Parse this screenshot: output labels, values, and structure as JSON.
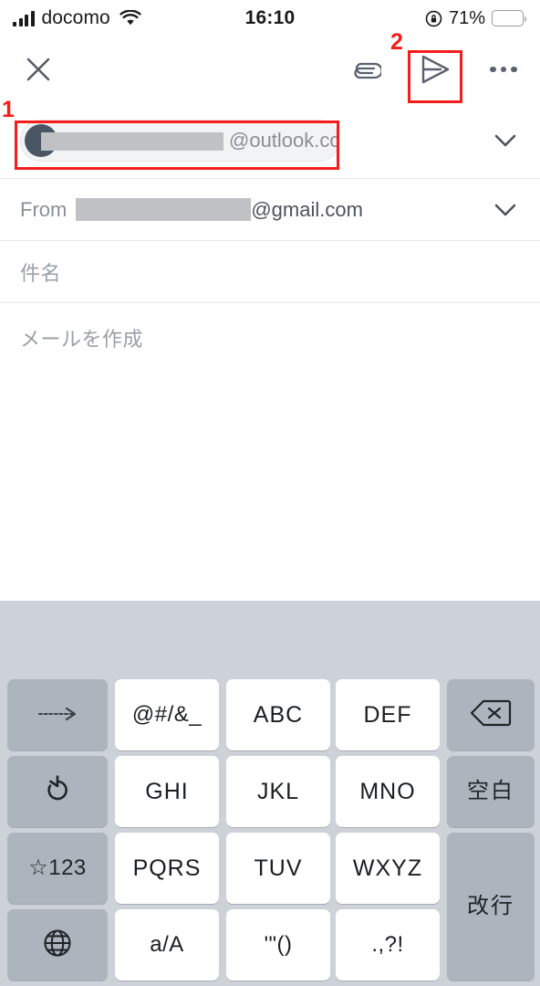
{
  "status_bar": {
    "carrier": "docomo",
    "time": "16:10",
    "battery_percent": "71%",
    "signal_icon": "signal-bars-icon",
    "wifi_icon": "wifi-icon",
    "rotation_lock_icon": "rotation-lock-icon",
    "battery_icon": "battery-icon"
  },
  "toolbar": {
    "close_icon": "close-x-icon",
    "attach_icon": "paperclip-icon",
    "send_icon": "send-paper-plane-icon",
    "more_icon": "more-options-icon"
  },
  "compose": {
    "to": {
      "chip_domain": "@outlook.com",
      "avatar_icon": "contact-avatar-icon",
      "expand_icon": "chevron-down-icon"
    },
    "from": {
      "label": "From",
      "domain": "@gmail.com",
      "expand_icon": "chevron-down-icon"
    },
    "subject_placeholder": "件名",
    "body_placeholder": "メールを作成"
  },
  "annotations": [
    {
      "number": "1",
      "target": "to-recipient-field",
      "color": "#f61c1c"
    },
    {
      "number": "2",
      "target": "send-button",
      "color": "#f61c1c"
    }
  ],
  "keyboard": {
    "rows": [
      [
        {
          "label": "→",
          "style": "gray",
          "name": "cursor-right-key",
          "type": "icon"
        },
        {
          "label": "@#/&_",
          "style": "white",
          "name": "symbols-key",
          "type": "sym"
        },
        {
          "label": "ABC",
          "style": "white",
          "name": "abc-key",
          "type": "text"
        },
        {
          "label": "DEF",
          "style": "white",
          "name": "def-key",
          "type": "text"
        },
        {
          "label": "⌫",
          "style": "gray",
          "name": "backspace-key",
          "type": "icon"
        }
      ],
      [
        {
          "label": "↺",
          "style": "gray",
          "name": "undo-key",
          "type": "icon"
        },
        {
          "label": "GHI",
          "style": "white",
          "name": "ghi-key",
          "type": "text"
        },
        {
          "label": "JKL",
          "style": "white",
          "name": "jkl-key",
          "type": "text"
        },
        {
          "label": "MNO",
          "style": "white",
          "name": "mno-key",
          "type": "text"
        },
        {
          "label": "空白",
          "style": "gray",
          "name": "space-key",
          "type": "jp"
        }
      ],
      [
        {
          "label": "☆123",
          "style": "gray",
          "name": "symbols-numbers-key",
          "type": "sym"
        },
        {
          "label": "PQRS",
          "style": "white",
          "name": "pqrs-key",
          "type": "text"
        },
        {
          "label": "TUV",
          "style": "white",
          "name": "tuv-key",
          "type": "text"
        },
        {
          "label": "WXYZ",
          "style": "white",
          "name": "wxyz-key",
          "type": "text"
        },
        {
          "label": "改行",
          "style": "gray",
          "name": "return-key",
          "type": "jp"
        }
      ],
      [
        {
          "label": "🌐",
          "style": "gray",
          "name": "globe-language-key",
          "type": "icon"
        },
        {
          "label": "a/A",
          "style": "white",
          "name": "case-toggle-key",
          "type": "sym"
        },
        {
          "label": "'\"()",
          "style": "white",
          "name": "quotes-brackets-key",
          "type": "sym"
        },
        {
          "label": ".,?!",
          "style": "white",
          "name": "punctuation-key",
          "type": "sym"
        }
      ]
    ]
  },
  "colors": {
    "annotation_red": "#f61c1c",
    "keyboard_bg": "#cdd1d8",
    "key_gray": "#aeb4bd",
    "key_white": "#ffffff",
    "placeholder_gray": "#9aa0a7",
    "redaction_gray": "#bfc1c4"
  }
}
